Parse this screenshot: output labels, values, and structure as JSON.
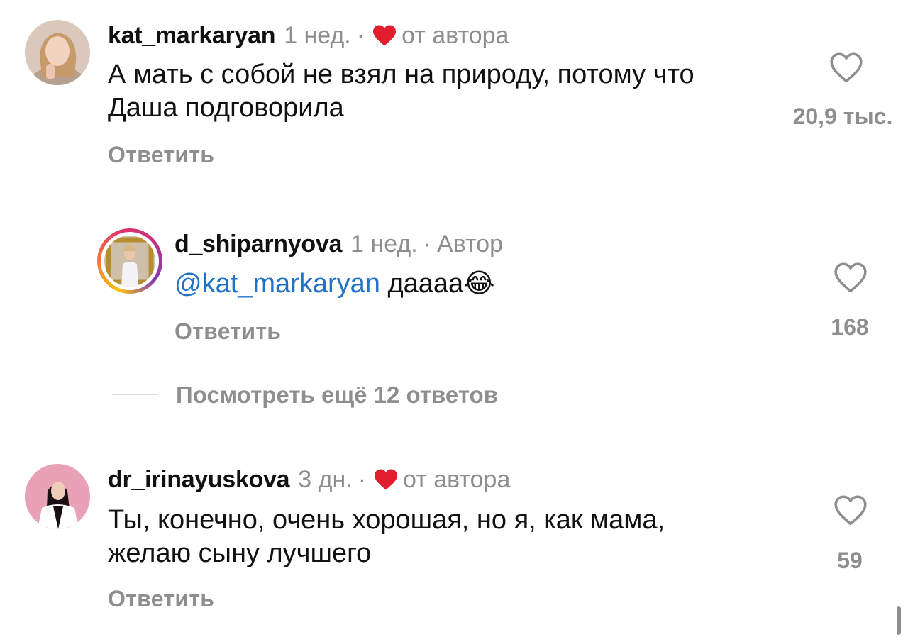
{
  "comments": [
    {
      "username": "kat_markaryan",
      "time": "1 нед.",
      "separator": "·",
      "author_like": "от автора",
      "text_lines": [
        "А мать с собой не взял на природу, потому что",
        "Даша подговорила"
      ],
      "reply_label": "Ответить",
      "likes": "20,9 тыс."
    },
    {
      "username": "d_shiparnyova",
      "time": "1 нед.",
      "separator": "·",
      "author_label": "Автор",
      "mention": "@kat_markaryan",
      "text": " дaaaa",
      "emoji": "😂",
      "reply_label": "Ответить",
      "likes": "168"
    },
    {
      "username": "dr_irinayuskova",
      "time": "3 дн.",
      "separator": "·",
      "author_like": "от автора",
      "text_lines": [
        "Ты, конечно, очень хорошая, но я, как мама,",
        "желаю сыну лучшего"
      ],
      "reply_label": "Ответить",
      "likes": "59"
    }
  ],
  "view_more": "Посмотреть ещё 12 ответов",
  "colors": {
    "like_red": "#e11d2e",
    "mention_blue": "#1f72c7",
    "secondary_gray": "#8e8e8e"
  },
  "icons": [
    "heart-outline-icon",
    "heart-filled-icon"
  ]
}
